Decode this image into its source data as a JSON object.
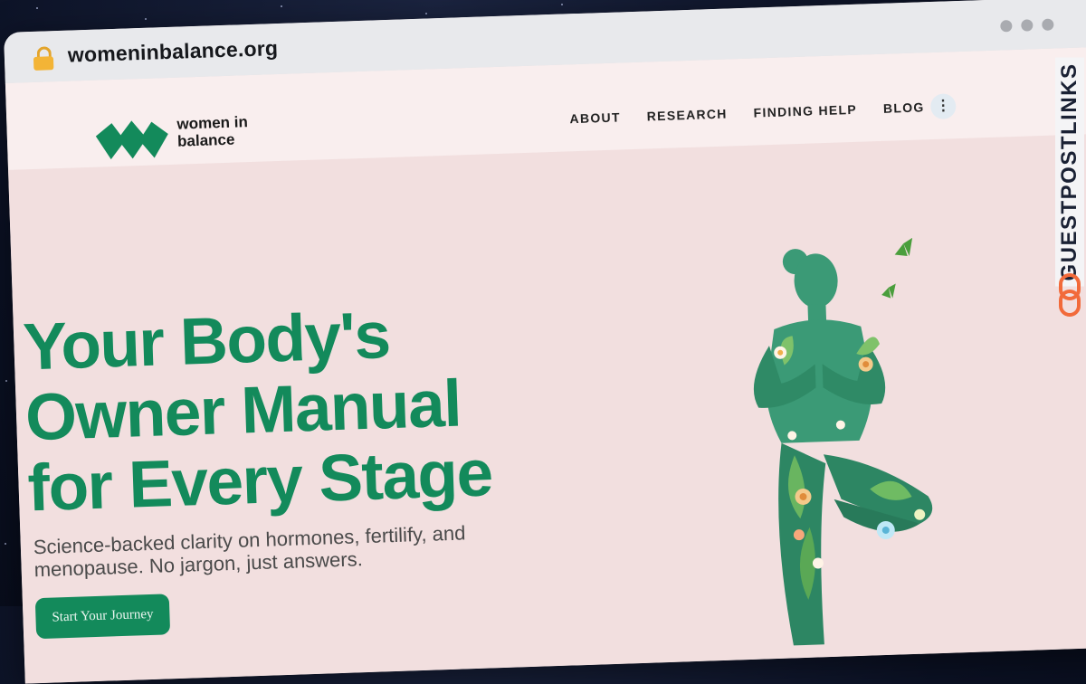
{
  "browser": {
    "url": "womeninbalance.org"
  },
  "header": {
    "logo_line1": "women in",
    "logo_line2": "balance",
    "nav": [
      "ABOUT",
      "RESEARCH",
      "FINDING HELP",
      "BLOG"
    ],
    "more_label": "⋮"
  },
  "hero": {
    "headline": "Your Body's Owner Manual for Every Stage",
    "subtext": "Science-backed clarity on hormones, fertilify, and menopause. No jargon, just answers.",
    "cta_label": "Start Your Journey"
  },
  "watermark": {
    "text": "GUESTPOSTLINKS"
  },
  "colors": {
    "brand_green": "#138a5b",
    "hero_bg": "#f2dfdf",
    "header_bg": "#f9eeee"
  }
}
